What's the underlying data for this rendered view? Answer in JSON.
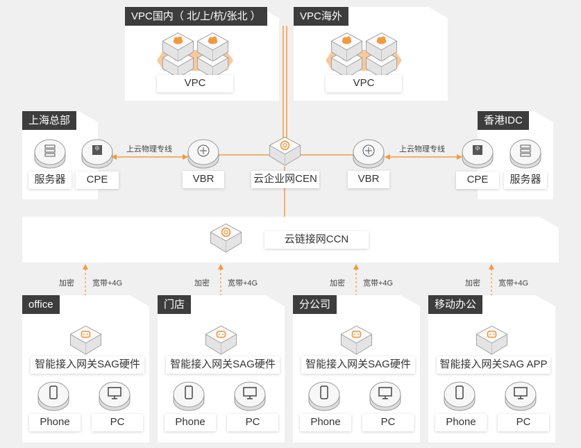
{
  "colors": {
    "accent": "#f39a3e",
    "tag_bg": "#3d3d3d",
    "background": "#f0f0f0"
  },
  "vpc_domestic": {
    "title": "VPC国内（ 北/上/杭/张北 ）",
    "label": "VPC"
  },
  "vpc_overseas": {
    "title": "VPC海外",
    "label": "VPC"
  },
  "shanghai_hq": {
    "title": "上海总部",
    "server": "服务器",
    "cpe": "CPE"
  },
  "hk_idc": {
    "title": "香港IDC",
    "server": "服务器",
    "cpe": "CPE"
  },
  "links": {
    "left_line": "上云物理专线",
    "right_line": "上云物理专线"
  },
  "vbr_left": "VBR",
  "vbr_right": "VBR",
  "cen": "云企业网CEN",
  "ccn": "云链接网CCN",
  "uplinks": [
    {
      "encrypt": "加密",
      "bandwidth": "宽带+4G"
    },
    {
      "encrypt": "加密",
      "bandwidth": "宽带+4G"
    },
    {
      "encrypt": "加密",
      "bandwidth": "宽带+4G"
    },
    {
      "encrypt": "加密",
      "bandwidth": "宽带+4G"
    }
  ],
  "branches": [
    {
      "title": "office",
      "gateway": "智能接入网关SAG硬件",
      "phone": "Phone",
      "pc": "PC"
    },
    {
      "title": "门店",
      "gateway": "智能接入网关SAG硬件",
      "phone": "Phone",
      "pc": "PC"
    },
    {
      "title": "分公司",
      "gateway": "智能接入网关SAG硬件",
      "phone": "Phone",
      "pc": "PC"
    },
    {
      "title": "移动办公",
      "gateway": "智能接入网关SAG APP",
      "phone": "Phone",
      "pc": "PC"
    }
  ]
}
